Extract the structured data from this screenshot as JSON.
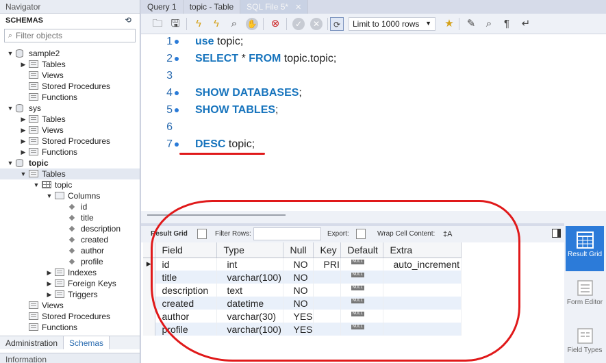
{
  "navigator": {
    "title": "Navigator",
    "schemas_label": "SCHEMAS",
    "filter_placeholder": "Filter objects",
    "tree": [
      {
        "label": "sample2",
        "level": 0,
        "type": "db",
        "expanded": true
      },
      {
        "label": "Tables",
        "level": 1,
        "type": "folder",
        "expanded": false
      },
      {
        "label": "Views",
        "level": 1,
        "type": "folder"
      },
      {
        "label": "Stored Procedures",
        "level": 1,
        "type": "folder"
      },
      {
        "label": "Functions",
        "level": 1,
        "type": "folder"
      },
      {
        "label": "sys",
        "level": 0,
        "type": "db",
        "expanded": true
      },
      {
        "label": "Tables",
        "level": 1,
        "type": "folder",
        "expanded": false
      },
      {
        "label": "Views",
        "level": 1,
        "type": "folder",
        "expanded": false
      },
      {
        "label": "Stored Procedures",
        "level": 1,
        "type": "folder",
        "expanded": false
      },
      {
        "label": "Functions",
        "level": 1,
        "type": "folder",
        "expanded": false
      },
      {
        "label": "topic",
        "level": 0,
        "type": "db",
        "expanded": true,
        "bold": true
      },
      {
        "label": "Tables",
        "level": 1,
        "type": "folder",
        "expanded": true,
        "selected": true
      },
      {
        "label": "topic",
        "level": 2,
        "type": "table",
        "expanded": true
      },
      {
        "label": "Columns",
        "level": 3,
        "type": "cols",
        "expanded": true
      },
      {
        "label": "id",
        "level": 4,
        "type": "column"
      },
      {
        "label": "title",
        "level": 4,
        "type": "column"
      },
      {
        "label": "description",
        "level": 4,
        "type": "column"
      },
      {
        "label": "created",
        "level": 4,
        "type": "column"
      },
      {
        "label": "author",
        "level": 4,
        "type": "column"
      },
      {
        "label": "profile",
        "level": 4,
        "type": "column"
      },
      {
        "label": "Indexes",
        "level": 3,
        "type": "folder",
        "expanded": false
      },
      {
        "label": "Foreign Keys",
        "level": 3,
        "type": "folder",
        "expanded": false
      },
      {
        "label": "Triggers",
        "level": 3,
        "type": "folder",
        "expanded": false
      },
      {
        "label": "Views",
        "level": 1,
        "type": "folder"
      },
      {
        "label": "Stored Procedures",
        "level": 1,
        "type": "folder"
      },
      {
        "label": "Functions",
        "level": 1,
        "type": "folder"
      }
    ],
    "tabs": [
      "Administration",
      "Schemas"
    ],
    "info_label": "Information"
  },
  "editor_tabs": [
    {
      "label": "Query 1",
      "active": false
    },
    {
      "label": "topic - Table",
      "active": false
    },
    {
      "label": "SQL File 5*",
      "active": true
    }
  ],
  "toolbar": {
    "limit_label": "Limit to 1000 rows"
  },
  "editor": {
    "lines": [
      {
        "num": "1",
        "parts": [
          {
            "t": "use",
            "kw": true
          },
          {
            "t": " topic;"
          }
        ]
      },
      {
        "num": "2",
        "parts": [
          {
            "t": "SELECT",
            "kw": true
          },
          {
            "t": " * "
          },
          {
            "t": "FROM",
            "kw": true
          },
          {
            "t": " topic.topic;"
          }
        ]
      },
      {
        "num": "3",
        "parts": []
      },
      {
        "num": "4",
        "parts": [
          {
            "t": "SHOW DATABASES",
            "kw": true
          },
          {
            "t": ";"
          }
        ]
      },
      {
        "num": "5",
        "parts": [
          {
            "t": "SHOW TABLES",
            "kw": true
          },
          {
            "t": ";"
          }
        ]
      },
      {
        "num": "6",
        "parts": []
      },
      {
        "num": "7",
        "parts": [
          {
            "t": "DESC",
            "kw": true
          },
          {
            "t": " topic;"
          }
        ]
      }
    ]
  },
  "result_toolbar": {
    "result_grid": "Result Grid",
    "filter_rows": "Filter Rows:",
    "export": "Export:",
    "wrap": "Wrap Cell Content:"
  },
  "grid": {
    "columns": [
      "Field",
      "Type",
      "Null",
      "Key",
      "Default",
      "Extra"
    ],
    "rows": [
      [
        "id",
        "int",
        "NO",
        "PRI",
        "NULL",
        "auto_increment"
      ],
      [
        "title",
        "varchar(100)",
        "NO",
        "",
        "NULL",
        ""
      ],
      [
        "description",
        "text",
        "NO",
        "",
        "NULL",
        ""
      ],
      [
        "created",
        "datetime",
        "NO",
        "",
        "NULL",
        ""
      ],
      [
        "author",
        "varchar(30)",
        "YES",
        "",
        "NULL",
        ""
      ],
      [
        "profile",
        "varchar(100)",
        "YES",
        "",
        "NULL",
        ""
      ]
    ]
  },
  "side_panel": [
    {
      "label": "Result Grid",
      "active": true
    },
    {
      "label": "Form Editor",
      "active": false
    },
    {
      "label": "Field Types",
      "active": false
    }
  ],
  "colors": {
    "keyword": "#1774bd",
    "annotation": "#e0191a",
    "accent": "#2c7bd9"
  }
}
